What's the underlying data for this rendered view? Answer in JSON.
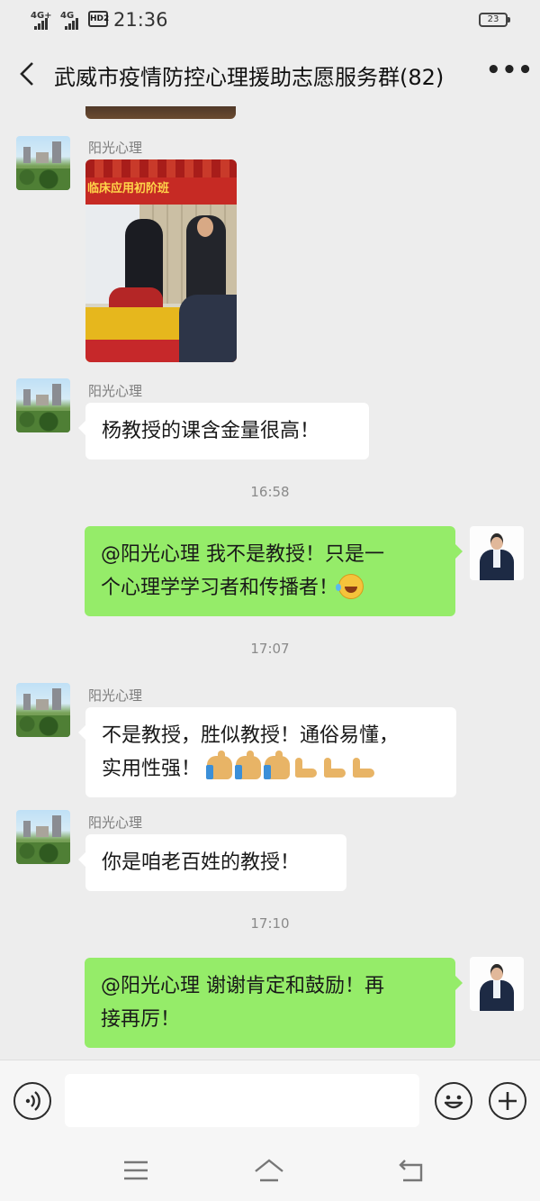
{
  "status_bar": {
    "network_1": "4G+",
    "network_2": "4G",
    "hd_badge": "HD2",
    "time": "21:36",
    "battery": "23"
  },
  "header": {
    "title": "武威市疫情防控心理援助志愿服务群(82)"
  },
  "messages": [
    {
      "type": "image",
      "sender": "阳光心理",
      "side": "left",
      "image_banner_text": "临床应用初阶班"
    },
    {
      "type": "text",
      "sender": "阳光心理",
      "side": "left",
      "text": "杨教授的课含金量很高！"
    },
    {
      "type": "timestamp",
      "text": "16:58"
    },
    {
      "type": "text",
      "side": "right",
      "line1": "@阳光心理  我不是教授！只是一",
      "line2": "个心理学学习者和传播者！",
      "emoji": [
        "laughing-tears"
      ]
    },
    {
      "type": "timestamp",
      "text": "17:07"
    },
    {
      "type": "text",
      "sender": "阳光心理",
      "side": "left",
      "line1": "不是教授，胜似教授！通俗易懂，",
      "line2": "实用性强！",
      "emoji": [
        "thumbs-up",
        "thumbs-up",
        "thumbs-up",
        "flexed-biceps",
        "flexed-biceps",
        "flexed-biceps"
      ]
    },
    {
      "type": "text",
      "sender": "阳光心理",
      "side": "left",
      "text": "你是咱老百姓的教授！"
    },
    {
      "type": "timestamp",
      "text": "17:10"
    },
    {
      "type": "text",
      "side": "right",
      "line1": "@阳光心理  谢谢肯定和鼓励！再",
      "line2": "接再厉！"
    }
  ],
  "input_bar": {
    "value": "",
    "placeholder": "",
    "icons": [
      "voice-icon",
      "emoji-icon",
      "plus-icon"
    ]
  },
  "nav_bar": {
    "icons": [
      "menu-icon",
      "home-icon",
      "back-nav-icon"
    ]
  },
  "colors": {
    "background": "#ededed",
    "bubble_self": "#95ec69",
    "bubble_other": "#ffffff",
    "text": "#191919",
    "meta_text": "#8a8a8a"
  }
}
